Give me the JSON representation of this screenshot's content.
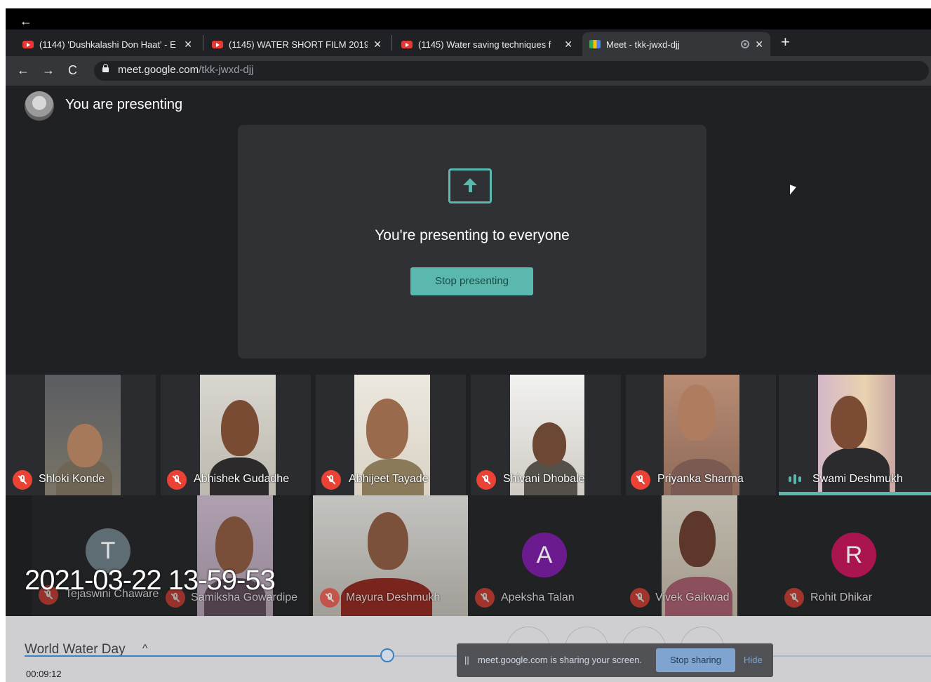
{
  "browser": {
    "back_glyph": "←",
    "tabs": [
      {
        "title": "(1144) 'Dushkalashi Don Haat' - E",
        "icon": "youtube-icon",
        "close": "✕"
      },
      {
        "title": "(1145) WATER SHORT FILM 2019",
        "icon": "youtube-icon",
        "close": "✕"
      },
      {
        "title": "(1145) Water saving techniques f",
        "icon": "youtube-icon",
        "close": "✕"
      },
      {
        "title": "Meet - tkk-jwxd-djj",
        "icon": "meet-icon",
        "close": "✕",
        "active": true
      }
    ],
    "new_tab": "+",
    "nav": {
      "back": "←",
      "forward": "→",
      "reload": "C"
    },
    "url_domain": "meet.google.com",
    "url_path": "/tkk-jwxd-djj"
  },
  "meet": {
    "presenting_label": "You are presenting",
    "present_message": "You're presenting to everyone",
    "stop_presenting": "Stop presenting",
    "accent": "#5bb8ae",
    "participants_row1": [
      {
        "name": "Shloki Konde",
        "muted": true
      },
      {
        "name": "Abhishek Gudadhe",
        "muted": true
      },
      {
        "name": "Abhijeet Tayade",
        "muted": true
      },
      {
        "name": "Shivani Dhobale",
        "muted": true
      },
      {
        "name": "Priyanka Sharma",
        "muted": true
      },
      {
        "name": "Swami Deshmukh",
        "muted": false,
        "speaking": true
      }
    ],
    "participants_row2": [
      {
        "name": "Tejaswini Chaware",
        "muted": true,
        "avatar_letter": "T",
        "avatar_color": "#6b7c85"
      },
      {
        "name": "Samiksha Gowardipe",
        "muted": true
      },
      {
        "name": "Mayura Deshmukh",
        "muted": true
      },
      {
        "name": "Apeksha Talan",
        "muted": true,
        "avatar_letter": "A",
        "avatar_color": "#7b1fa2"
      },
      {
        "name": "Vivek Gaikwad",
        "muted": true
      },
      {
        "name": "Rohit Dhikar",
        "muted": true,
        "avatar_letter": "R",
        "avatar_color": "#c2185b"
      }
    ]
  },
  "overlay_timestamp": "2021-03-22 13-59-53",
  "player": {
    "title": "World Water Day",
    "chevron": "^",
    "elapsed": "00:09:12",
    "progress_fraction": 0.4
  },
  "share_bar": {
    "pause_glyph": "||",
    "message": "meet.google.com is sharing your screen.",
    "stop_sharing": "Stop sharing",
    "hide": "Hide"
  }
}
